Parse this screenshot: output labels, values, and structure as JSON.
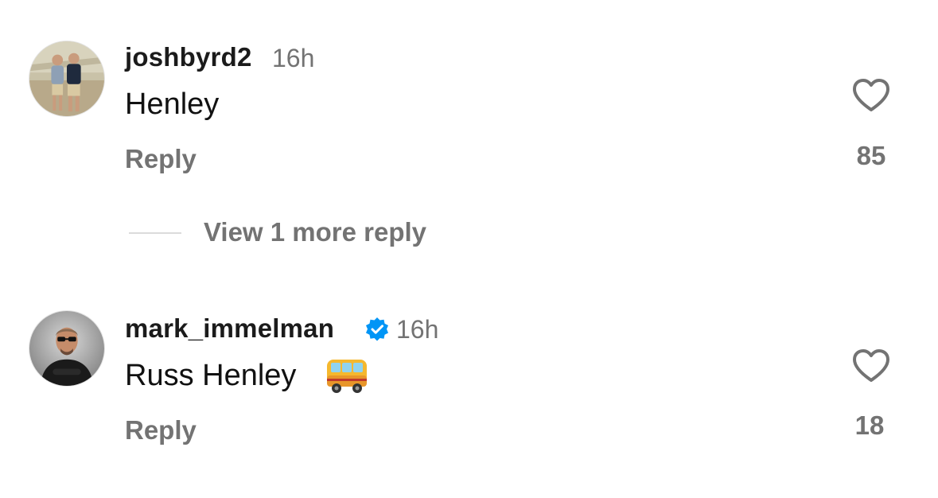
{
  "comments": [
    {
      "username": "joshbyrd2",
      "time": "16h",
      "text": "Henley",
      "reply_label": "Reply",
      "likes": "85",
      "verified": false,
      "icons": [
        "avatar",
        "heart-icon"
      ]
    },
    {
      "username": "mark_immelman",
      "time": "16h",
      "text": "Russ Henley",
      "reply_label": "Reply",
      "likes": "18",
      "verified": true,
      "icons": [
        "avatar",
        "verified-badge-icon",
        "bus-emoji-icon",
        "heart-icon"
      ]
    }
  ],
  "view_more_replies": "View 1 more reply",
  "colors": {
    "text_primary": "#111111",
    "text_secondary": "#737373",
    "verified_blue": "#0095f6",
    "divider": "#dbdbdb"
  }
}
